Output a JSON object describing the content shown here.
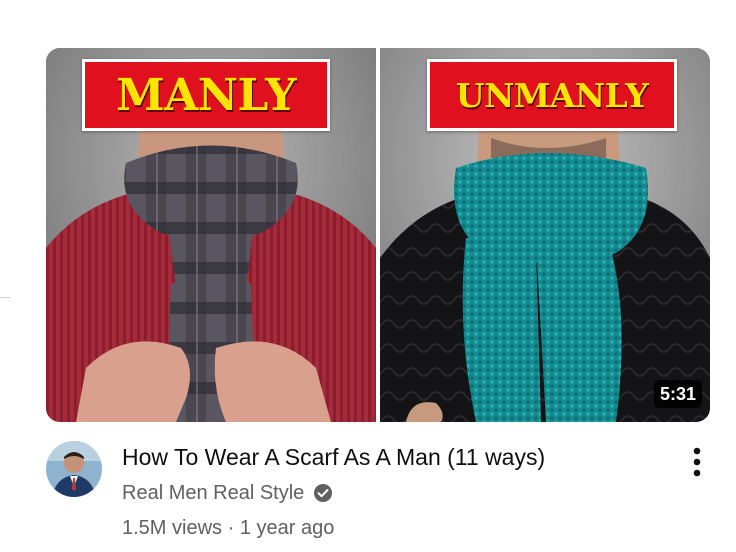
{
  "video": {
    "thumbnail": {
      "left_banner_text": "MANLY",
      "right_banner_text": "UNMANLY",
      "duration": "5:31"
    },
    "title": "How To Wear A Scarf As A Man (11 ways)",
    "channel": "Real Men Real Style",
    "channel_verified": true,
    "views": "1.5M views",
    "separator": "·",
    "published": "1 year ago",
    "menu_icon": "kebab-menu-icon",
    "verified_icon": "verified-check-icon"
  },
  "colors": {
    "banner_red": "#e0101f",
    "banner_yellow": "#ffe400",
    "teal_scarf": "#138a8f",
    "red_sweater": "#a8283a",
    "title_text": "#0f0f0f",
    "secondary_text": "#606060"
  }
}
